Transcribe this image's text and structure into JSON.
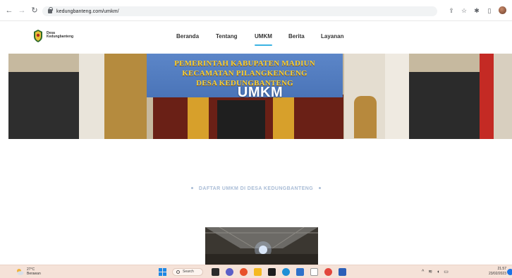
{
  "browser": {
    "url": "kedungbanteng.com/umkm/"
  },
  "site": {
    "logo_text_line1": "Desa",
    "logo_text_line2": "Kedungbanteng",
    "nav": [
      {
        "label": "Beranda"
      },
      {
        "label": "Tentang"
      },
      {
        "label": "UMKM",
        "active": true
      },
      {
        "label": "Berita"
      },
      {
        "label": "Layanan"
      }
    ],
    "accent_color": "#3ab3e3"
  },
  "hero": {
    "banner_lines": [
      "PEMERINTAH KABUPATEN MADIUN",
      "KECAMATAN PILANGKENCENG",
      "DESA KEDUNGBANTENG"
    ],
    "title": "UMKM"
  },
  "section": {
    "label": "DAFTAR UMKM DI DESA KEDUNGBANTENG"
  },
  "taskbar": {
    "weather_temp": "27°C",
    "weather_desc": "Berawan",
    "search_label": "Search",
    "time": "21.57",
    "date": "23/02/2023"
  }
}
